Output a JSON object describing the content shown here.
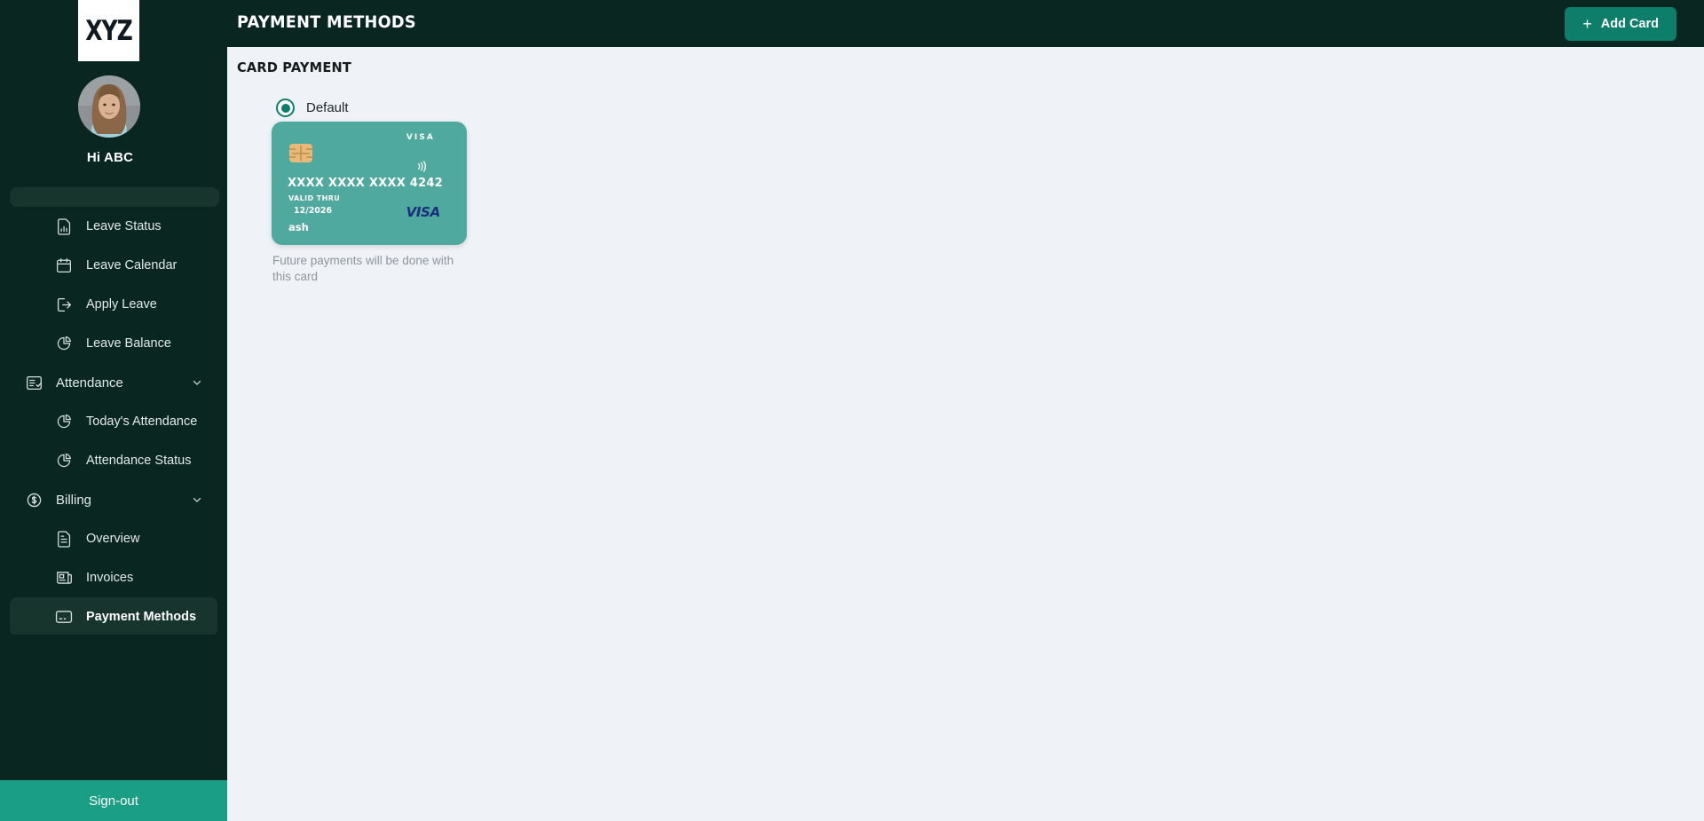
{
  "brand": {
    "logo_text": "XYZ",
    "logo_bg": "#ffffff",
    "sidebar_bg": "#0a2620",
    "accent": "#0c7e6a",
    "signout_bg": "#1a9e85",
    "card_bg": "#4fa99e",
    "page_bg": "#eff2f7"
  },
  "sidebar": {
    "greeting": "Hi ABC",
    "avatar_name": "user-avatar",
    "partial_item_label": "",
    "items": [
      {
        "label": "Leave Status",
        "icon": "file-chart-icon",
        "level": "child",
        "active": false
      },
      {
        "label": "Leave Calendar",
        "icon": "calendar-icon",
        "level": "child",
        "active": false
      },
      {
        "label": "Apply Leave",
        "icon": "logout-arrow-icon",
        "level": "child",
        "active": false
      },
      {
        "label": "Leave Balance",
        "icon": "pie-chart-icon",
        "level": "child",
        "active": false
      },
      {
        "label": "Attendance",
        "icon": "checklist-icon",
        "level": "group",
        "active": false,
        "expandable": true
      },
      {
        "label": "Today's Attendance",
        "icon": "pie-chart-icon",
        "level": "child",
        "active": false
      },
      {
        "label": "Attendance Status",
        "icon": "pie-chart-icon",
        "level": "child",
        "active": false
      },
      {
        "label": "Billing",
        "icon": "dollar-circle-icon",
        "level": "group",
        "active": false,
        "expandable": true
      },
      {
        "label": "Overview",
        "icon": "document-icon",
        "level": "child",
        "active": false
      },
      {
        "label": "Invoices",
        "icon": "invoice-icon",
        "level": "child",
        "active": false
      },
      {
        "label": "Payment Methods",
        "icon": "credit-card-icon",
        "level": "child",
        "active": true
      }
    ],
    "signout_label": "Sign-out"
  },
  "header": {
    "title": "PAYMENT METHODS",
    "menu_icon": "hamburger-icon",
    "add_card": {
      "label": "Add Card",
      "icon": "plus-icon"
    }
  },
  "main": {
    "section_title": "CARD PAYMENT",
    "default_option": {
      "label": "Default",
      "selected": true
    },
    "card": {
      "brand_top": "VISA",
      "number": "XXXX XXXX XXXX 4242",
      "valid_thru_label": "VALID THRU",
      "valid_thru_value": "12/2026",
      "holder": "ash",
      "brand_logo": "VISA",
      "chip_icon": "emv-chip-icon",
      "contactless_icon": "contactless-icon"
    },
    "card_note": "Future payments will be done with this card"
  }
}
